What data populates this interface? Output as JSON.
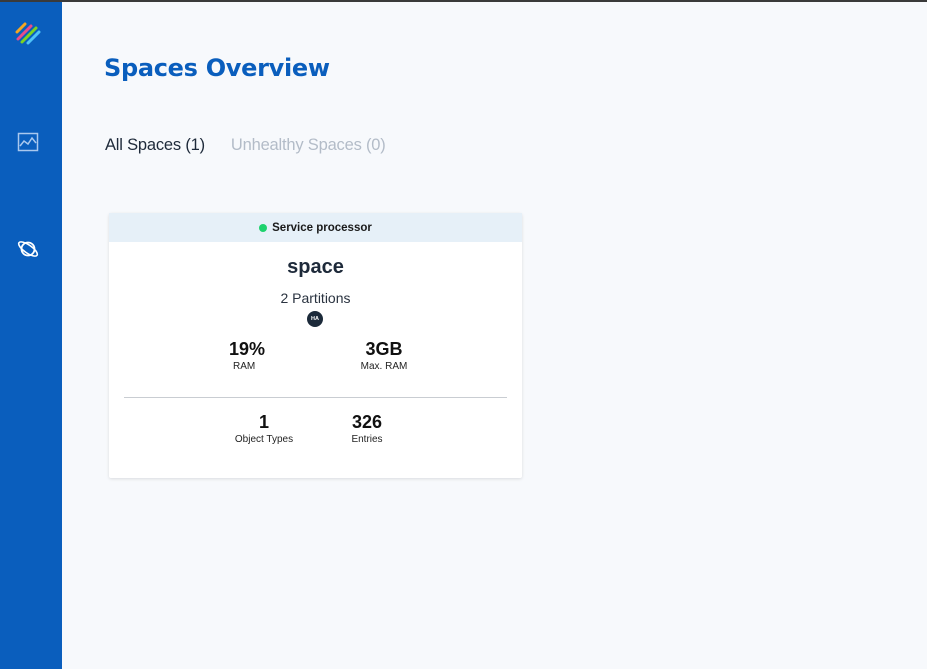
{
  "sidebar": {
    "items": [
      {
        "icon": "logo-icon"
      },
      {
        "icon": "chart-icon"
      },
      {
        "icon": "planet-icon"
      }
    ]
  },
  "page": {
    "title": "Spaces Overview"
  },
  "tabs": [
    {
      "label": "All Spaces (1)",
      "active": true
    },
    {
      "label": "Unhealthy Spaces (0)",
      "active": false
    }
  ],
  "card": {
    "status_color": "#1ed26d",
    "processor": "Service processor",
    "name": "space",
    "partitions": "2 Partitions",
    "badge": "HA",
    "ram_value": "19%",
    "ram_label": "RAM",
    "max_ram_value": "3GB",
    "max_ram_label": "Max. RAM",
    "object_types_value": "1",
    "object_types_label": "Object Types",
    "entries_value": "326",
    "entries_label": "Entries"
  },
  "colors": {
    "sidebar": "#0a5ebd",
    "title": "#0a5ebd"
  }
}
